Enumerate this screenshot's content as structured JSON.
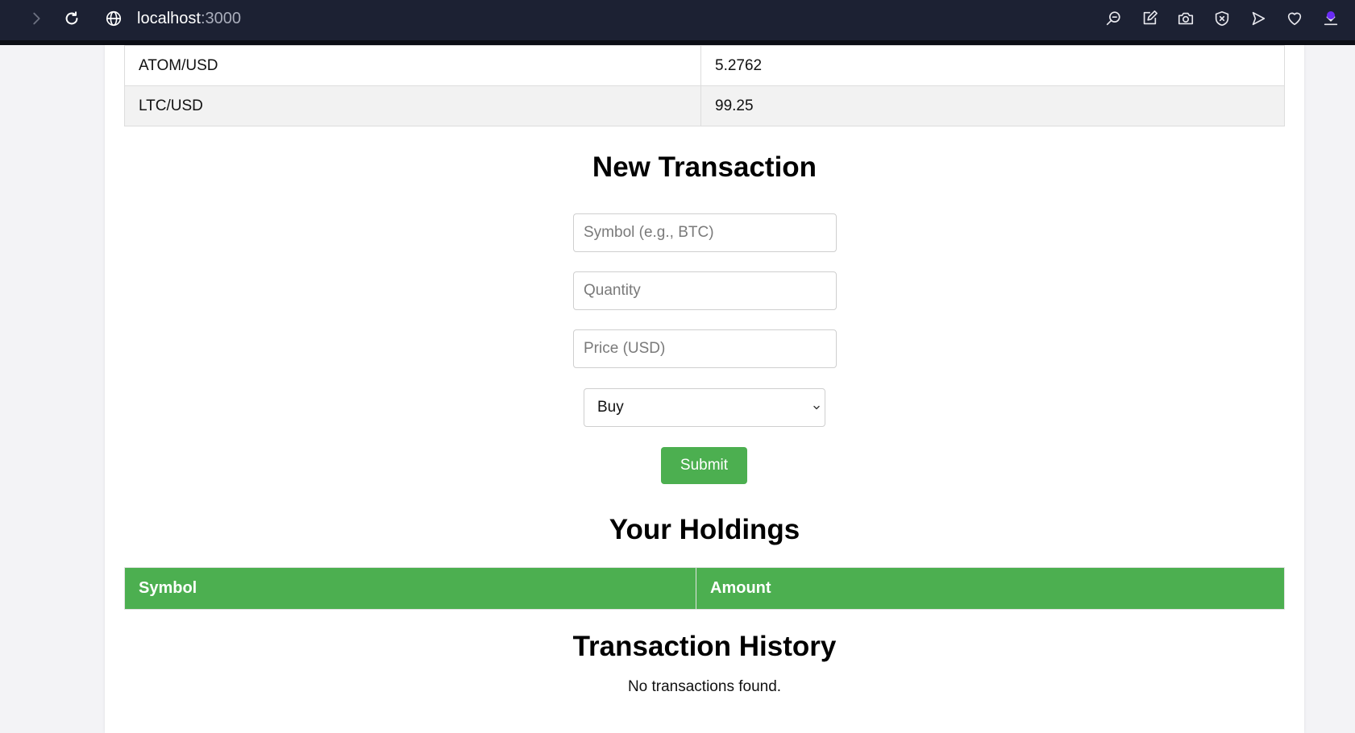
{
  "browser": {
    "url_host": "localhost",
    "url_port": ":3000",
    "icons": [
      "forward-icon",
      "reload-icon",
      "globe-icon",
      "zoom-icon",
      "edit-icon",
      "camera-icon",
      "shield-icon",
      "send-icon",
      "heart-icon",
      "download-icon"
    ],
    "download_badge_color": "#6a2cf5",
    "bar_color": "#1c2133"
  },
  "prices": {
    "rows": [
      {
        "pair": "ATOM/USD",
        "price": "5.2762"
      },
      {
        "pair": "LTC/USD",
        "price": "99.25"
      }
    ]
  },
  "new_transaction": {
    "title": "New Transaction",
    "symbol_placeholder": "Symbol (e.g., BTC)",
    "quantity_placeholder": "Quantity",
    "price_placeholder": "Price (USD)",
    "type_selected": "Buy",
    "submit_label": "Submit",
    "accent_color": "#4caf50"
  },
  "holdings": {
    "title": "Your Holdings",
    "columns": [
      "Symbol",
      "Amount"
    ]
  },
  "history": {
    "title": "Transaction History",
    "empty_message": "No transactions found."
  }
}
